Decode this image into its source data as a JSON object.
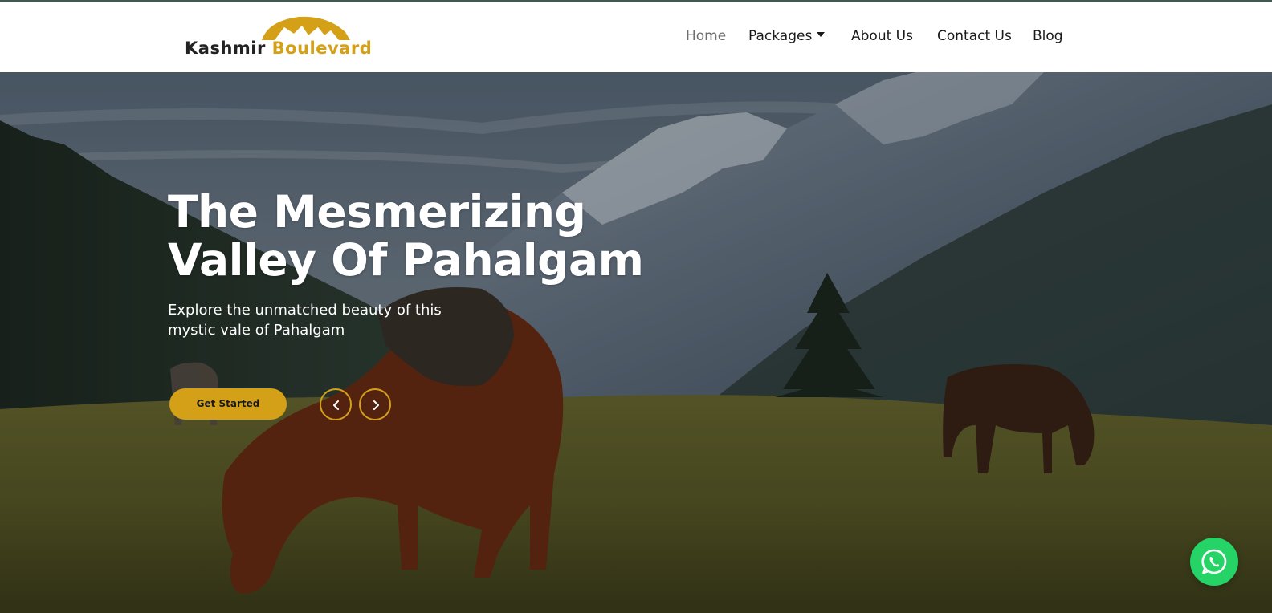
{
  "brand": {
    "word1": "Kashmir",
    "word2": "Boulevard",
    "accent_color": "#d4a017"
  },
  "nav": {
    "items": [
      {
        "label": "Home",
        "active": true
      },
      {
        "label": "Packages",
        "has_dropdown": true
      },
      {
        "label": "About Us"
      },
      {
        "label": "Contact Us"
      },
      {
        "label": "Blog"
      }
    ]
  },
  "hero": {
    "title_line1": "The Mesmerizing",
    "title_line2": "Valley Of Pahalgam",
    "subtitle_line1": "Explore the unmatched beauty of this",
    "subtitle_line2": "mystic vale of Pahalgam",
    "cta_label": "Get Started",
    "prev_icon": "chevron-left-icon",
    "next_icon": "chevron-right-icon"
  },
  "floating": {
    "icon": "whatsapp-icon",
    "color": "#25d366"
  }
}
